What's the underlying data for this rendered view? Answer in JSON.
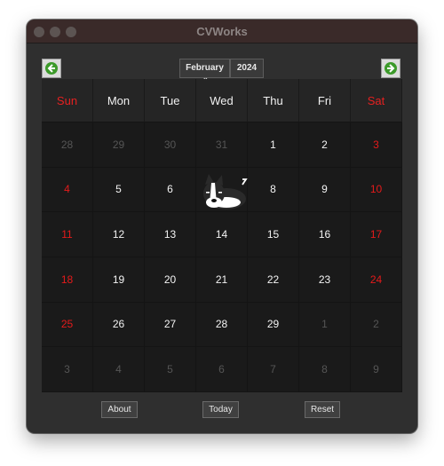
{
  "window": {
    "title": "CVWorks"
  },
  "nav": {
    "prev_icon": "arrow-left-icon",
    "next_icon": "arrow-right-icon",
    "month": "February",
    "year": "2024"
  },
  "weekdays": [
    "Sun",
    "Mon",
    "Tue",
    "Wed",
    "Thu",
    "Fri",
    "Sat"
  ],
  "days": [
    [
      "28",
      "29",
      "30",
      "31",
      "1",
      "2",
      "3"
    ],
    [
      "4",
      "5",
      "6",
      "7",
      "8",
      "9",
      "10"
    ],
    [
      "11",
      "12",
      "13",
      "14",
      "15",
      "16",
      "17"
    ],
    [
      "18",
      "19",
      "20",
      "21",
      "22",
      "23",
      "24"
    ],
    [
      "25",
      "26",
      "27",
      "28",
      "29",
      "1",
      "2"
    ],
    [
      "3",
      "4",
      "5",
      "6",
      "7",
      "8",
      "9"
    ]
  ],
  "other_month_flags": [
    [
      true,
      true,
      true,
      true,
      false,
      false,
      false
    ],
    [
      false,
      false,
      false,
      false,
      false,
      false,
      false
    ],
    [
      false,
      false,
      false,
      false,
      false,
      false,
      false
    ],
    [
      false,
      false,
      false,
      false,
      false,
      false,
      false
    ],
    [
      false,
      false,
      false,
      false,
      false,
      true,
      true
    ],
    [
      true,
      true,
      true,
      true,
      true,
      true,
      true
    ]
  ],
  "buttons": {
    "about": "About",
    "today": "Today",
    "reset": "Reset"
  },
  "colors": {
    "weekend": "#e41a1a",
    "accent_arrow": "#3c9a2a",
    "window_bg": "#2f2f2f"
  }
}
